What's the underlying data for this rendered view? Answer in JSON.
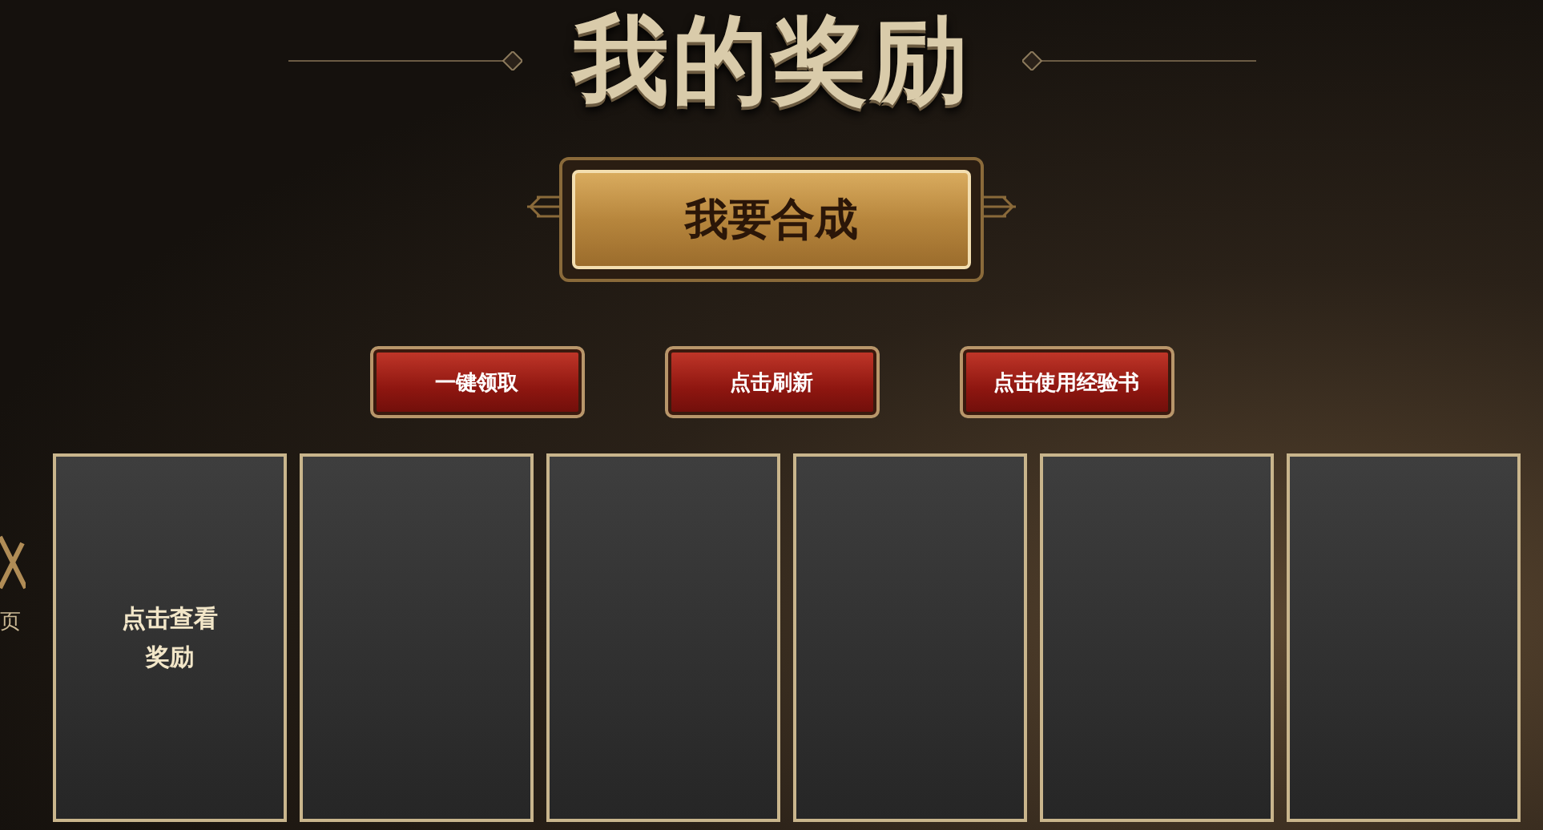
{
  "title": "我的奖励",
  "main_button": {
    "label": "我要合成"
  },
  "actions": [
    {
      "label": "一键领取"
    },
    {
      "label": "点击刷新"
    },
    {
      "label": "点击使用经验书"
    }
  ],
  "side_tab": {
    "label": "页"
  },
  "slots": [
    {
      "kind": "label",
      "label": "点击查看奖励"
    },
    {
      "kind": "blank"
    },
    {
      "kind": "blank"
    },
    {
      "kind": "blank"
    },
    {
      "kind": "blank"
    },
    {
      "kind": "blank"
    }
  ]
}
